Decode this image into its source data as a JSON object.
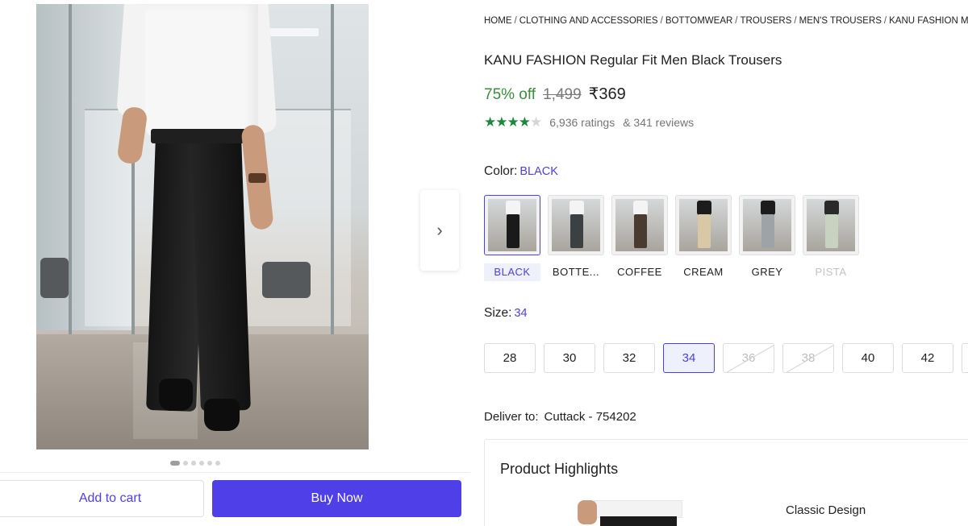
{
  "breadcrumb": [
    "HOME",
    "CLOTHING AND ACCESSORIES",
    "BOTTOMWEAR",
    "TROUSERS",
    "MEN'S TROUSERS",
    "KANU FASHION ME"
  ],
  "product": {
    "title": "KANU FASHION Regular Fit Men Black Trousers",
    "discount": "75% off",
    "mrp": "1,499",
    "price": "₹369",
    "rating_stars": 4,
    "ratings_text": "6,936 ratings",
    "reviews_text": "& 341 reviews"
  },
  "color": {
    "label": "Color:",
    "selected": "BLACK",
    "options": [
      {
        "label": "BLACK",
        "torso": "#f4f4f4",
        "pants": "#1a1a1a"
      },
      {
        "label": "BOTTE...",
        "torso": "#f4f4f4",
        "pants": "#3b4043"
      },
      {
        "label": "COFFEE",
        "torso": "#f4f4f4",
        "pants": "#4a3a30"
      },
      {
        "label": "CREAM",
        "torso": "#1c1c1c",
        "pants": "#d9c8a5"
      },
      {
        "label": "GREY",
        "torso": "#1c1c1c",
        "pants": "#9ea3a8"
      },
      {
        "label": "PISTA",
        "torso": "#2a2a2a",
        "pants": "#c7d3c0"
      }
    ]
  },
  "size": {
    "label": "Size:",
    "selected": "34",
    "options": [
      "28",
      "30",
      "32",
      "34",
      "36",
      "38",
      "40",
      "42"
    ]
  },
  "delivery": {
    "label": "Deliver to:",
    "location": "Cuttack - 754202"
  },
  "actions": {
    "add_to_cart": "Add to cart",
    "buy_now": "Buy Now"
  },
  "highlights": {
    "title": "Product Highlights",
    "feature": "Classic Design"
  },
  "gallery": {
    "image_count": 6,
    "active_index": 0,
    "next_icon": "chevron-right-icon"
  },
  "colors": {
    "accent": "#4f3fe8",
    "discount": "#388e3c",
    "star": "#1a8a3a"
  }
}
